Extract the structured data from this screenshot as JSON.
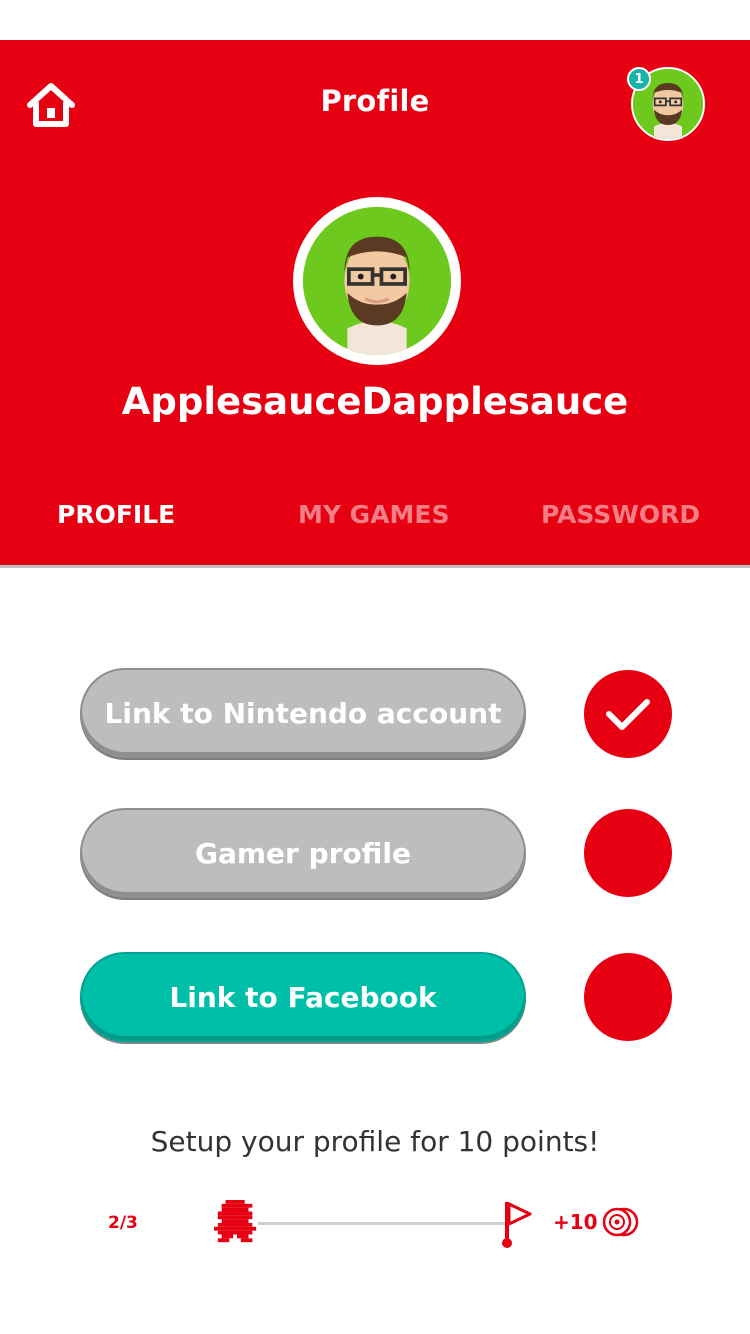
{
  "header": {
    "title": "Profile",
    "notification_count": "1",
    "username": "ApplesauceDapplesauce",
    "bg_color": "#e60012"
  },
  "tabs": [
    {
      "label": "PROFILE",
      "active": true
    },
    {
      "label": "MY GAMES",
      "active": false
    },
    {
      "label": "PASSWORD",
      "active": false
    }
  ],
  "actions": [
    {
      "label": "Link to Nintendo account",
      "style": "gray",
      "completed": true
    },
    {
      "label": "Gamer profile",
      "style": "gray",
      "completed": false
    },
    {
      "label": "Link to Facebook",
      "style": "teal",
      "completed": false
    }
  ],
  "progress": {
    "message": "Setup your profile for 10 points!",
    "count": "2/3",
    "reward": "+10"
  },
  "icons": {
    "home": "home-icon",
    "check": "check-icon",
    "runner": "pixel-mario-icon",
    "flag": "goal-flag-icon",
    "coin": "platinum-points-icon"
  }
}
